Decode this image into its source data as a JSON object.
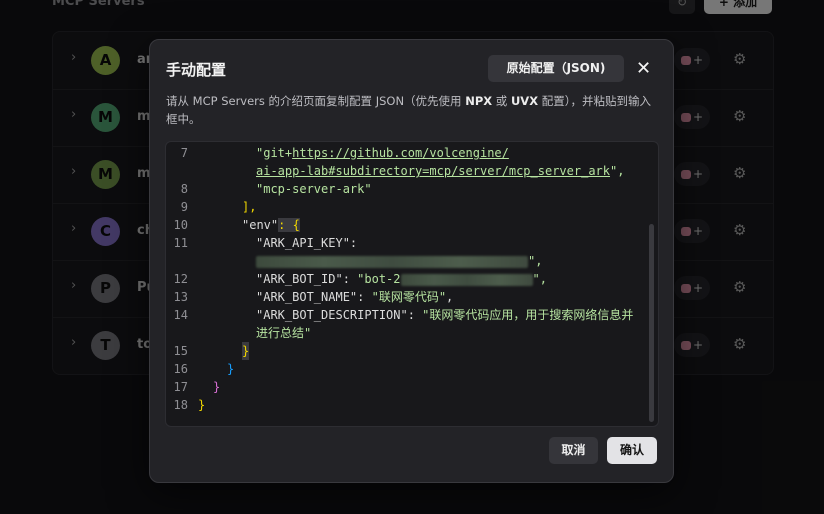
{
  "background": {
    "section_title": "MCP Servers",
    "refresh_icon": "refresh-icon",
    "add_label": "+ 添加",
    "servers": [
      {
        "initial": "A",
        "name": "ar",
        "color": "#8fb04a"
      },
      {
        "initial": "M",
        "name": "m",
        "color": "#4e9c6c"
      },
      {
        "initial": "M",
        "name": "m",
        "color": "#6c8f46"
      },
      {
        "initial": "C",
        "name": "ch",
        "color": "#7b68b8"
      },
      {
        "initial": "P",
        "name": "Pu",
        "color": "#6e6e74"
      },
      {
        "initial": "T",
        "name": "to",
        "color": "#6e6e74"
      }
    ],
    "tool_suffix": "+"
  },
  "modal": {
    "title": "手动配置",
    "raw_config_label": "原始配置（JSON)",
    "close_icon": "close-icon",
    "description_prefix": "请从 MCP Servers 的介绍页面复制配置 JSON（优先使用 ",
    "description_npx": "NPX",
    "description_mid": " 或 ",
    "description_uvx": "UVX",
    "description_suffix": " 配置），并粘贴到输入框中。",
    "cancel_label": "取消",
    "confirm_label": "确认"
  },
  "editor": {
    "line_numbers": [
      "7",
      "8",
      "9",
      "10",
      "11",
      "12",
      "13",
      "14",
      "15",
      "16",
      "17",
      "18"
    ],
    "l7_a": "\"git+",
    "l7_url1": "https://github.com/volcengine/",
    "l7_url2": "ai-app-lab#subdirectory=mcp/server/mcp_server_ark",
    "l7_end": "\",",
    "l8": "\"mcp-server-ark\"",
    "l9": "],",
    "l10_key": "\"env\"",
    "l10_rest": ": {",
    "l11_key": "\"ARK_API_KEY\":",
    "l11_end": "\",",
    "l12_key": "\"ARK_BOT_ID\": ",
    "l12_val": "\"bot-2",
    "l12_end": "\",",
    "l13_key": "\"ARK_BOT_NAME\": ",
    "l13_val": "\"联网零代码\"",
    "l13_end": ",",
    "l14_key": "\"ARK_BOT_DESCRIPTION\": ",
    "l14_val1": "\"联网零代码应用，用于搜索网络信息并",
    "l14_val2": "进行总结\"",
    "l15": "}",
    "l16": "}",
    "l17": "}",
    "l18": "}"
  }
}
